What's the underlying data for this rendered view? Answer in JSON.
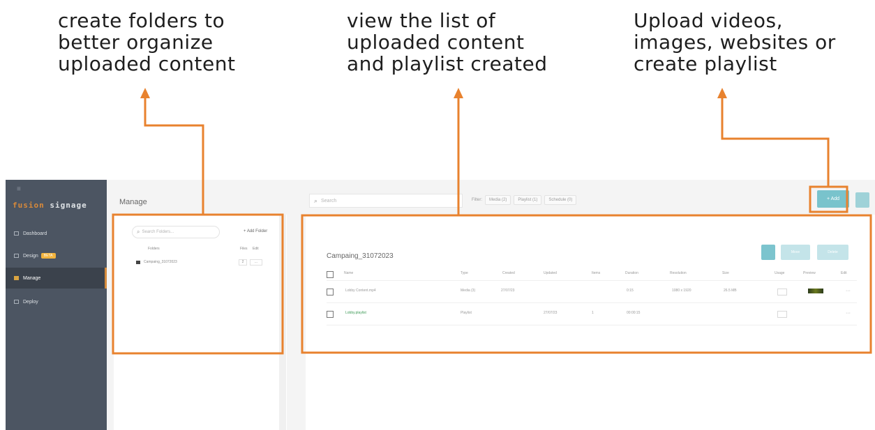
{
  "callouts": {
    "folders": [
      "create folders to",
      "better organize",
      "uploaded content"
    ],
    "list": [
      "view the list of",
      "uploaded content",
      "and playlist created"
    ],
    "upload": [
      "Upload videos,",
      "images, websites or",
      "create playlist"
    ]
  },
  "colors": {
    "annotation": "#e8822e",
    "sidebar": "#4c5562",
    "accent": "#79c3cc",
    "badge": "#f3b43e"
  },
  "sidebar": {
    "brand_part1": "fusion",
    "brand_part2": "signage",
    "items": [
      {
        "label": "Dashboard",
        "icon": "dashboard-icon"
      },
      {
        "label": "Design",
        "icon": "design-icon",
        "badge": "BETA"
      },
      {
        "label": "Manage",
        "icon": "folder-icon",
        "active": true
      },
      {
        "label": "Deploy",
        "icon": "deploy-icon"
      }
    ]
  },
  "header": {
    "title": "Manage",
    "search_placeholder": "Search",
    "filter_label": "Filter:",
    "filters": [
      "Media (2)",
      "Playlist (1)",
      "Schedule (0)"
    ],
    "add_label": "+ Add"
  },
  "folders": {
    "search_placeholder": "Search Folders...",
    "add_folder_label": "+ Add Folder",
    "col_folders": "Folders",
    "col_files": "Files",
    "col_edit": "Edit",
    "rows": [
      {
        "name": "Campaing_31072023",
        "files": "2",
        "edit": "..."
      }
    ]
  },
  "content": {
    "folder_title": "Campaing_31072023",
    "action_delete": "Delete",
    "action_move": "Move",
    "columns": [
      "Name",
      "Type",
      "Created",
      "Updated",
      "Items",
      "Duration",
      "Resolution",
      "Size",
      "Usage",
      "Preview",
      "Edit"
    ],
    "rows": [
      {
        "name": "Lobby Content.mp4",
        "type": "Media (3)",
        "created": "27/07/23",
        "updated": "",
        "items": "",
        "duration": "0:15",
        "resolution": "1080 x 1920",
        "size": "26.5 MB",
        "edit": "···",
        "playlist": false
      },
      {
        "name": "Lobby.playlist",
        "type": "Playlist",
        "created": "",
        "updated": "27/07/23",
        "items": "1",
        "duration": "00:00:15",
        "resolution": "",
        "size": "",
        "edit": "···",
        "playlist": true
      }
    ]
  }
}
